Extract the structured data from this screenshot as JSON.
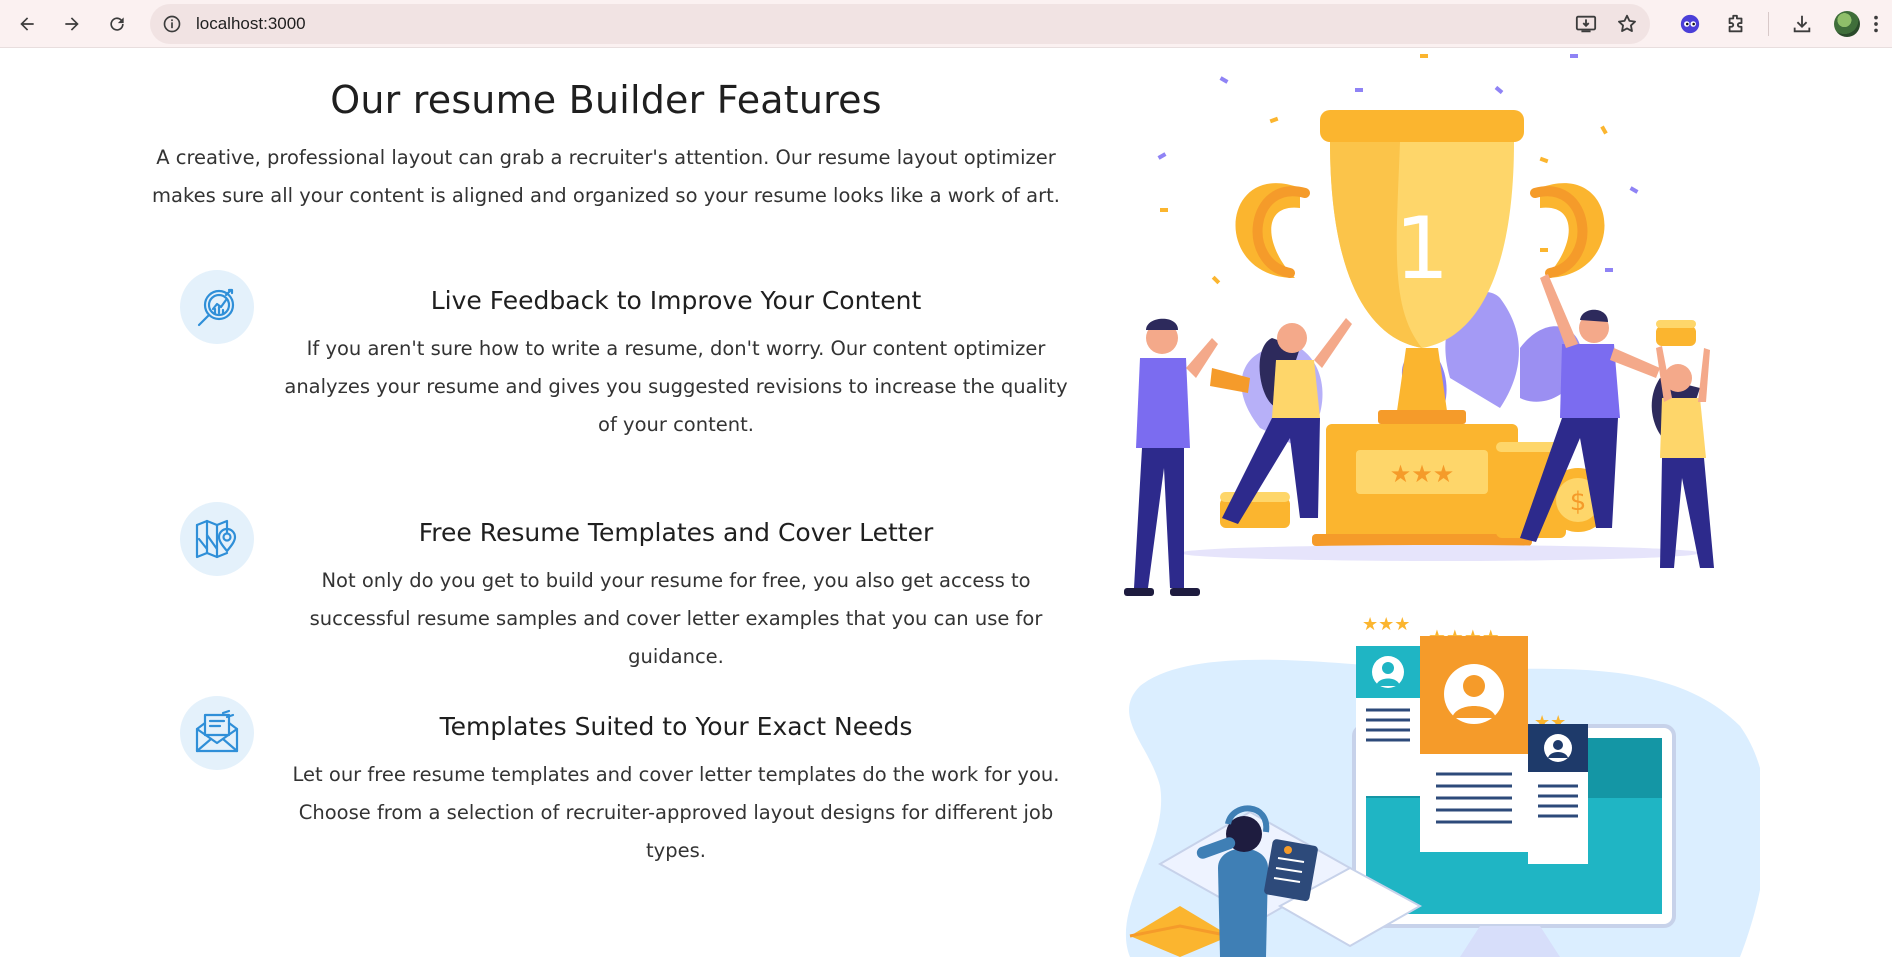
{
  "browser": {
    "url": "localhost:3000",
    "icons": [
      "back-arrow-icon",
      "forward-arrow-icon",
      "reload-icon",
      "site-info-icon",
      "install-app-icon",
      "bookmark-star-icon",
      "extension-eyes-icon",
      "extensions-puzzle-icon",
      "download-icon",
      "profile-avatar"
    ]
  },
  "page": {
    "title": "Our resume Builder Features",
    "description": "A creative, professional layout can grab a recruiter's attention. Our resume layout optimizer makes sure all your content is aligned and organized so your resume looks like a work of art."
  },
  "features": [
    {
      "icon": "analytics-magnifier-icon",
      "title": "Live Feedback to Improve Your Content",
      "description": "If you aren't sure how to write a resume, don't worry. Our content optimizer analyzes your resume and gives you suggested revisions to increase the quality of your content."
    },
    {
      "icon": "map-location-icon",
      "title": "Free Resume Templates and Cover Letter",
      "description": "Not only do you get to build your resume for free, you also get access to successful resume samples and cover letter examples that you can use for guidance."
    },
    {
      "icon": "envelope-letter-icon",
      "title": "Templates Suited to Your Exact Needs",
      "description": "Let our free resume templates and cover letter templates do the work for you. Choose from a selection of recruiter-approved layout designs for different job types."
    }
  ],
  "illustrations": {
    "trophy_number": "1",
    "colors": {
      "trophy": "#fbb52f",
      "trophy_light": "#fed66a",
      "purple": "#7b6cf0",
      "navy": "#2d2a8c",
      "teal": "#1fb5c4",
      "orange": "#f59b2a",
      "light_blue": "#dbeeff"
    }
  }
}
